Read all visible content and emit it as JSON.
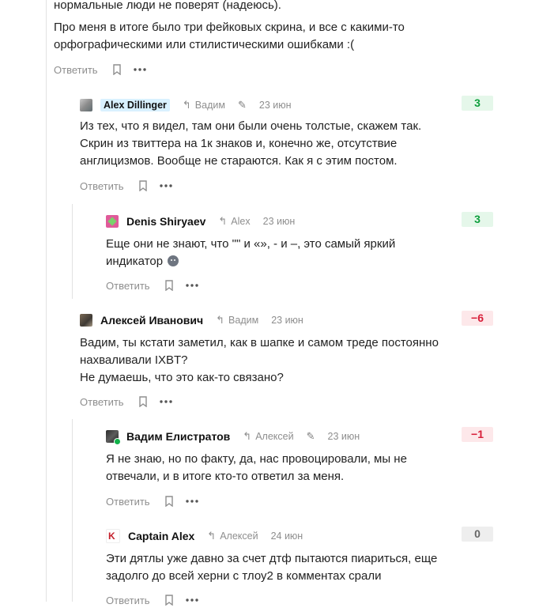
{
  "top_comment": {
    "text_lines": [
      "нормальные люди не поверят (надеюсь).",
      "Про меня в итоге было три фейковых скрина, и все с какими-то",
      "орфографическими или стилистическими ошибками :("
    ],
    "reply_label": "Ответить"
  },
  "comments": [
    {
      "author": "Alex Dillinger",
      "reply_to": "Вадим",
      "date": "23 июн",
      "score": "3",
      "text_lines": [
        "Из тех, что я видел, там они были очень толстые, скажем так.",
        "Скрин из твиттера на 1к знаков и, конечно же, отсутствие",
        "англицизмов. Вообще не стараются. Как я с этим постом."
      ],
      "reply_label": "Ответить"
    },
    {
      "author": "Denis Shiryaev",
      "reply_to": "Alex",
      "date": "23 июн",
      "score": "3",
      "text_lines": [
        "Еще они не знают, что \"\" и «», - и –, это самый яркий",
        "индикатор"
      ],
      "reply_label": "Ответить"
    },
    {
      "author": "Алексей Иванович",
      "reply_to": "Вадим",
      "date": "23 июн",
      "score": "−6",
      "text_lines": [
        "Вадим, ты кстати заметил, как в шапке и самом треде постоянно",
        "нахваливали IXBT?",
        "Не думаешь, что это как-то связано?"
      ],
      "reply_label": "Ответить"
    },
    {
      "author": "Вадим Елистратов",
      "reply_to": "Алексей",
      "date": "23 июн",
      "score": "−1",
      "text_lines": [
        "Я не знаю, но по факту, да, нас провоцировали, мы не",
        "отвечали, и в итоге кто-то ответил за меня."
      ],
      "reply_label": "Ответить"
    },
    {
      "author": "Captain Alex",
      "reply_to": "Алексей",
      "date": "24 июн",
      "score": "0",
      "text_lines": [
        "Эти дятлы уже давно за счет дтф пытаются пиариться, еще",
        "задолго до всей херни с тлоу2 в комментах срали"
      ],
      "reply_label": "Ответить"
    }
  ],
  "icons": {
    "reply_arrow": "reply-arrow-icon",
    "edit": "pencil-icon",
    "bookmark": "bookmark-icon",
    "more": "more-dots-icon",
    "emoji": "neutral-face-emoji-icon"
  },
  "colors": {
    "positive": "#0e9f3d",
    "negative": "#d81f3a",
    "neutral": "#666666",
    "author_highlight": "#d9f1ff",
    "online": "#12b24a"
  }
}
